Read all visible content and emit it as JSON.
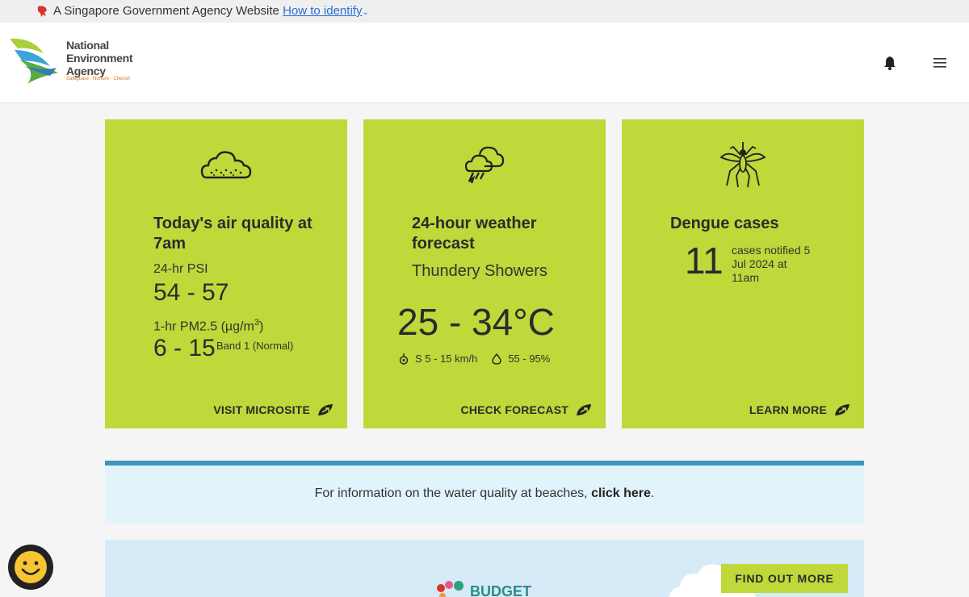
{
  "masthead": {
    "text": "A Singapore Government Agency Website",
    "link": "How to identify"
  },
  "logo": {
    "line1": "National",
    "line2": "Environment",
    "line3": "Agency",
    "tagline": "Safeguard · Nurture · Cherish"
  },
  "cards": {
    "air": {
      "title": "Today's air quality at 7am",
      "psi_label": "24-hr PSI",
      "psi_value": "54 - 57",
      "pm_label": "1-hr PM2.5 (µg/m",
      "pm_sup": "3",
      "pm_close": ")",
      "pm_value": "6 - 15",
      "pm_band": "Band 1 (Normal)",
      "cta": "VISIT MICROSITE"
    },
    "weather": {
      "title": "24-hour weather forecast",
      "condition": "Thundery Showers",
      "temp": "25 - 34°C",
      "wind": "S 5 - 15 km/h",
      "humidity": "55 - 95%",
      "cta": "CHECK FORECAST"
    },
    "dengue": {
      "title": "Dengue cases",
      "count": "11",
      "note": "cases notified 5 Jul 2024 at 11am",
      "cta": "LEARN MORE"
    }
  },
  "notice": {
    "text": "For information on the water quality at beaches, ",
    "link": "click here",
    "end": "."
  },
  "banner": {
    "budget": "BUDGET",
    "button": "FIND OUT MORE"
  },
  "colors": {
    "card_bg": "#bfd83a",
    "notice_bar": "#3b95bd",
    "notice_bg": "#e1f3fb"
  }
}
